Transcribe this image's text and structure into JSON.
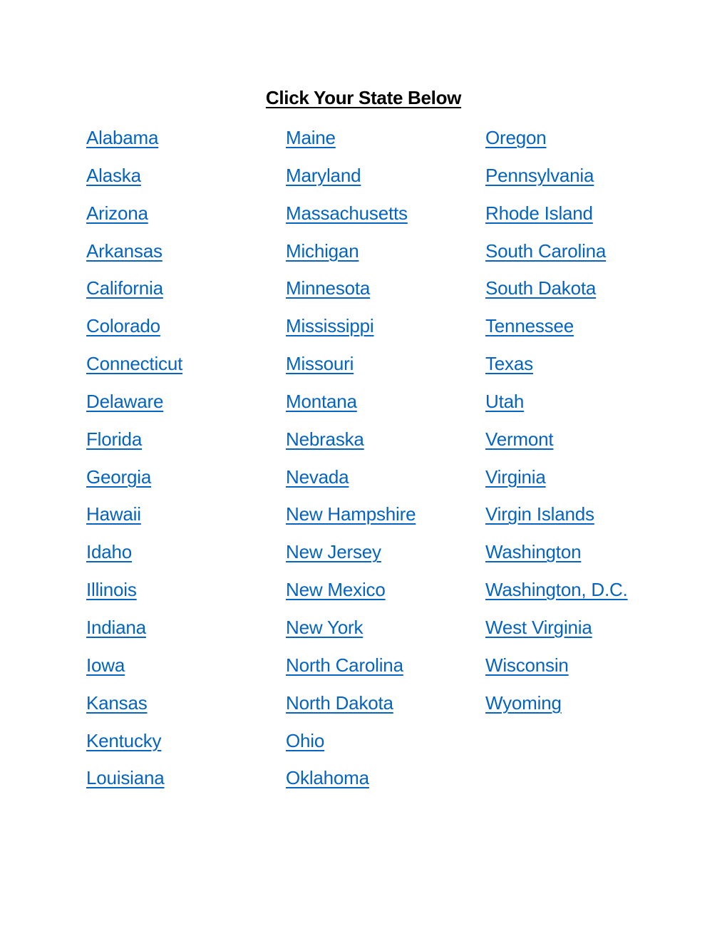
{
  "title": "Click Your State Below",
  "link_color": "#0563C1",
  "columns": [
    {
      "states": [
        "Alabama",
        "Alaska",
        "Arizona",
        "Arkansas",
        "California",
        "Colorado",
        "Connecticut",
        "Delaware",
        "Florida",
        "Georgia",
        "Hawaii",
        "Idaho",
        "Illinois",
        "Indiana",
        "Iowa",
        "Kansas",
        "Kentucky",
        "Louisiana"
      ]
    },
    {
      "states": [
        "Maine",
        "Maryland",
        "Massachusetts",
        "Michigan",
        "Minnesota",
        "Mississippi",
        "Missouri",
        "Montana",
        "Nebraska",
        "Nevada",
        "New Hampshire",
        "New Jersey",
        "New Mexico",
        "New York",
        "North Carolina",
        "North Dakota",
        "Ohio",
        "Oklahoma"
      ]
    },
    {
      "states": [
        "Oregon",
        "Pennsylvania",
        "Rhode Island",
        "South Carolina",
        "South Dakota",
        "Tennessee",
        "Texas",
        "Utah",
        "Vermont",
        "Virginia",
        "Virgin Islands",
        "Washington",
        "Washington, D.C.",
        "West Virginia",
        "Wisconsin",
        "Wyoming"
      ]
    }
  ]
}
